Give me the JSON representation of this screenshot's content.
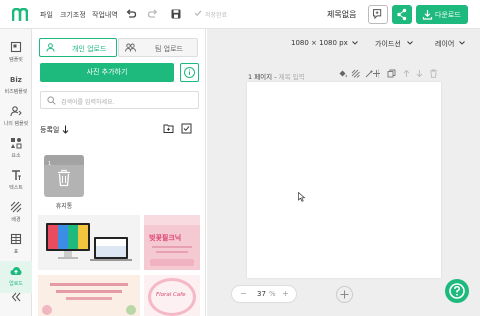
{
  "topbar": {
    "menus": [
      "파일",
      "크기조정",
      "작업내역"
    ],
    "autosave": "저장완료",
    "doc_title": "제목없음",
    "download_label": "다운로드"
  },
  "rail": {
    "items": [
      {
        "label": "템플릿",
        "icon": "template-icon"
      },
      {
        "label": "비즈템플릿",
        "icon": "biz-template-icon"
      },
      {
        "label": "나의 템플릿",
        "icon": "my-template-icon"
      },
      {
        "label": "요소",
        "icon": "elements-icon"
      },
      {
        "label": "텍스트",
        "icon": "text-icon"
      },
      {
        "label": "배경",
        "icon": "background-icon"
      },
      {
        "label": "표",
        "icon": "table-icon"
      },
      {
        "label": "업로드",
        "icon": "upload-icon",
        "active": true
      }
    ]
  },
  "panel": {
    "tab_personal": "개인 업로드",
    "tab_team": "팀 업로드",
    "add_photo": "사진 추가하기",
    "search_placeholder": "검색어를 입력하세요.",
    "sort_label": "등록일",
    "trash_label": "휴지통",
    "thumbnails": [
      {
        "text": ""
      },
      {
        "text": "벚꽃필크닉"
      },
      {
        "text": "Floral Cafe"
      }
    ]
  },
  "canvas": {
    "size": "1080 × 1080 px",
    "guides": "가이드선",
    "layers": "레이어",
    "page_label": "1 페이지 -",
    "page_title_placeholder": "제목 입력",
    "zoom_value": "37",
    "zoom_unit": "%",
    "accent": "#1db97d"
  }
}
